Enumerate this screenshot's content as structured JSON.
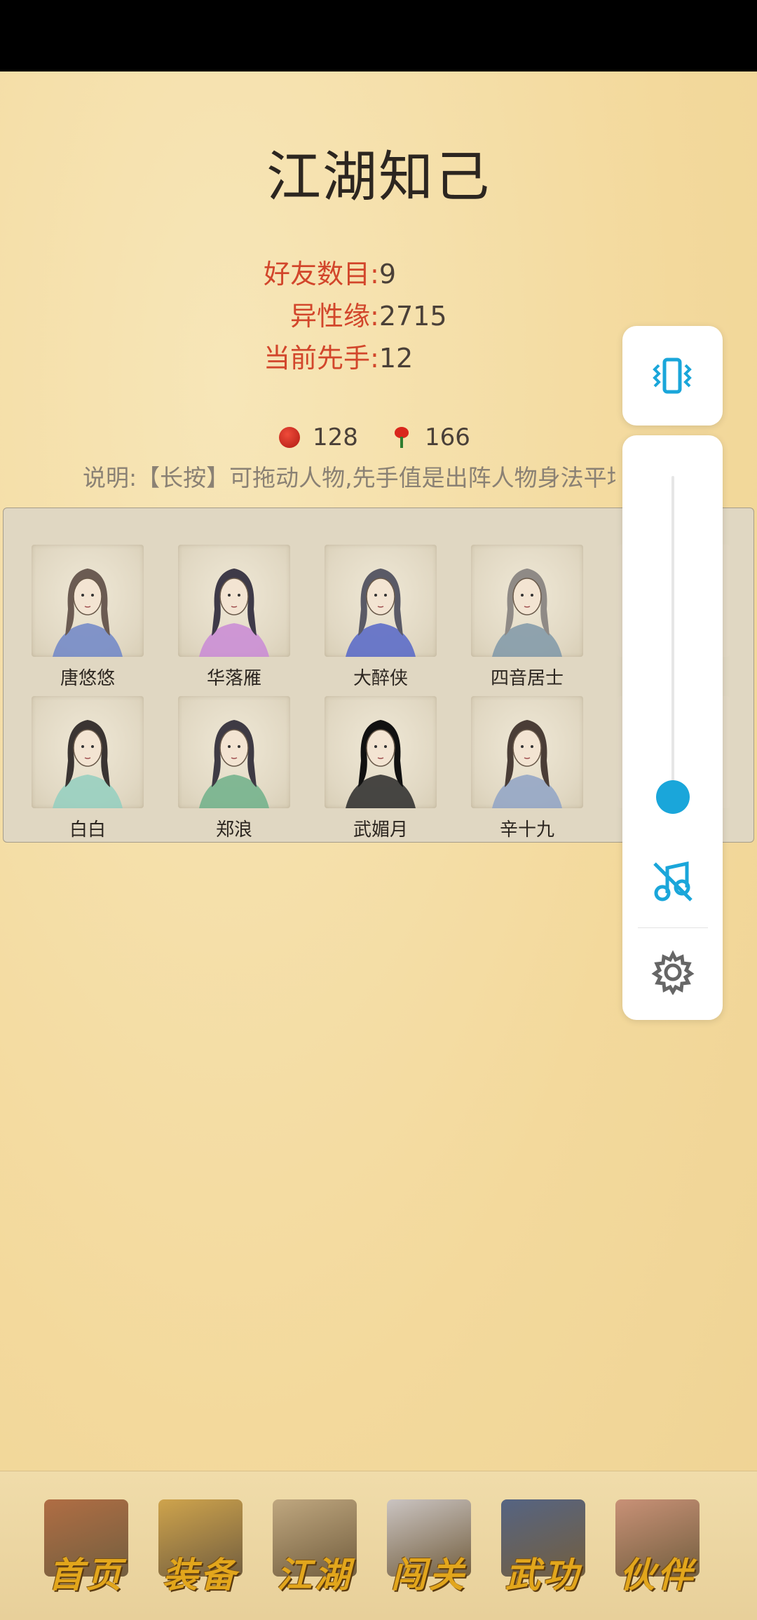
{
  "title": "江湖知己",
  "stats": [
    {
      "label": "好友数目:",
      "value": "9"
    },
    {
      "label": "异性缘:",
      "value": "2715"
    },
    {
      "label": "当前先手:",
      "value": "12"
    }
  ],
  "currency": {
    "red_coin": "128",
    "rose": "166"
  },
  "note": "说明:【长按】可拖动人物,先手值是出阵人物身法平均",
  "characters": [
    {
      "name": "唐悠悠",
      "hair": "#6b5b52",
      "robe": "#6f86c8"
    },
    {
      "name": "华落雁",
      "hair": "#3e3a48",
      "robe": "#c98ad6"
    },
    {
      "name": "大醉侠",
      "hair": "#5a5a66",
      "robe": "#5566c8"
    },
    {
      "name": "四音居士",
      "hair": "#8f8a86",
      "robe": "#7f98a8"
    },
    {
      "name": "白白",
      "hair": "#3a3432",
      "robe": "#93cfc0"
    },
    {
      "name": "郑浪",
      "hair": "#3e3a44",
      "robe": "#6fb08a"
    },
    {
      "name": "武媚月",
      "hair": "#111111",
      "robe": "#2a2a2a"
    },
    {
      "name": "辛十九",
      "hair": "#4a3d36",
      "robe": "#8fa3c6"
    }
  ],
  "settings": {
    "vibrate_icon": "vibrate-icon",
    "music_off_icon": "music-off-icon",
    "gear_icon": "gear-icon",
    "volume_level": 0.05
  },
  "nav": [
    {
      "label": "首页",
      "art": "#a55a32"
    },
    {
      "label": "装备",
      "art": "#c99a3c"
    },
    {
      "label": "江湖",
      "art": "#b79e78"
    },
    {
      "label": "闯关",
      "art": "#c4c0c6"
    },
    {
      "label": "武功",
      "art": "#3a4f7c"
    },
    {
      "label": "伙伴",
      "art": "#c2846e"
    }
  ],
  "colors": {
    "accent": "#1aa6da",
    "stat_label": "#d2462b",
    "nav_label": "#e2a61c"
  }
}
